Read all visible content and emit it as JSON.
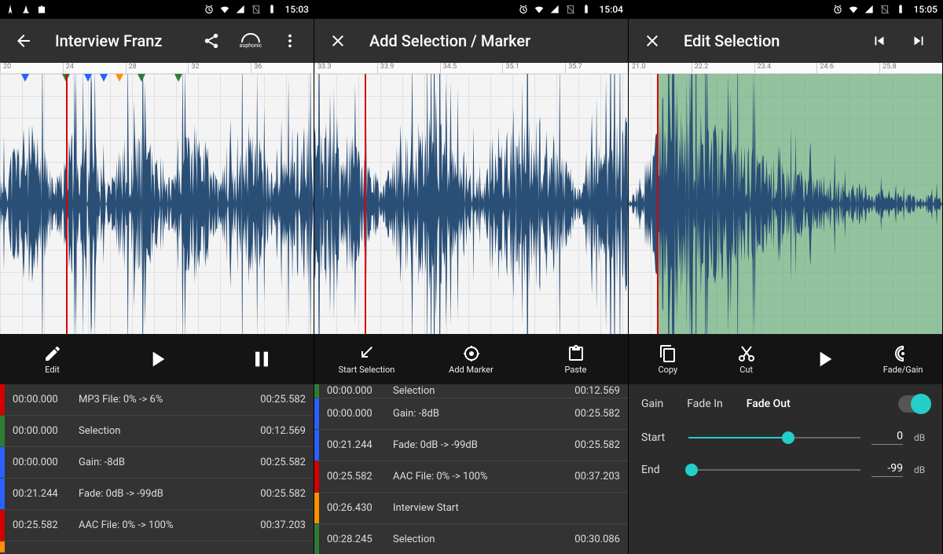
{
  "phones": [
    {
      "status": {
        "time": "15:03"
      },
      "appbar": {
        "nav_icon": "back",
        "title": "Interview Franz",
        "actions": [
          "share",
          "auphonic",
          "overflow"
        ]
      },
      "ruler": [
        "20",
        "24",
        "28",
        "32",
        "36"
      ],
      "playhead_pct": 21,
      "markers": [
        {
          "pct": 8,
          "color": "blue"
        },
        {
          "pct": 21,
          "color": "green"
        },
        {
          "pct": 28,
          "color": "blue"
        },
        {
          "pct": 33,
          "color": "blue"
        },
        {
          "pct": 38,
          "color": "orange"
        },
        {
          "pct": 45,
          "color": "green"
        },
        {
          "pct": 57,
          "color": "green"
        }
      ],
      "controls": [
        {
          "icon": "edit",
          "label": "Edit"
        },
        {
          "icon": "play",
          "label": ""
        },
        {
          "icon": "pause",
          "label": ""
        }
      ],
      "rows": [
        {
          "color": "#d50000",
          "start": "00:00.000",
          "label": "MP3 File: 0% -> 6%",
          "end": "00:25.582"
        },
        {
          "color": "#2e7d32",
          "start": "00:00.000",
          "label": "Selection",
          "end": "00:12.569"
        },
        {
          "color": "#2962ff",
          "start": "00:00.000",
          "label": "Gain: -8dB",
          "end": "00:25.582"
        },
        {
          "color": "#2962ff",
          "start": "00:21.244",
          "label": "Fade: 0dB -> -99dB",
          "end": "00:25.582"
        },
        {
          "color": "#d50000",
          "start": "00:25.582",
          "label": "AAC File: 0% -> 100%",
          "end": "00:37.203"
        }
      ],
      "row_partial_bottom": {
        "color": "#ff9100"
      }
    },
    {
      "status": {
        "time": "15:04"
      },
      "appbar": {
        "nav_icon": "close",
        "title": "Add Selection / Marker",
        "actions": []
      },
      "ruler": [
        "33.3",
        "33.9",
        "34.5",
        "35.1",
        "35.7"
      ],
      "playhead_pct": 16,
      "markers": [],
      "controls": [
        {
          "icon": "crop",
          "label": "Start Selection"
        },
        {
          "icon": "target",
          "label": "Add Marker"
        },
        {
          "icon": "clipboard",
          "label": "Paste"
        }
      ],
      "row_partial_top": {
        "color": "#2e7d32",
        "start": "00:00.000",
        "label": "Selection",
        "end": "00:12.569"
      },
      "rows": [
        {
          "color": "#2962ff",
          "start": "00:00.000",
          "label": "Gain: -8dB",
          "end": "00:25.582"
        },
        {
          "color": "#2962ff",
          "start": "00:21.244",
          "label": "Fade: 0dB -> -99dB",
          "end": "00:25.582"
        },
        {
          "color": "#d50000",
          "start": "00:25.582",
          "label": "AAC File: 0% -> 100%",
          "end": "00:37.203"
        },
        {
          "color": "#ff9100",
          "start": "00:26.430",
          "label": "Interview Start",
          "end": ""
        },
        {
          "color": "#2e7d32",
          "start": "00:28.245",
          "label": "Selection",
          "end": "00:30.086"
        }
      ]
    },
    {
      "status": {
        "time": "15:05"
      },
      "appbar": {
        "nav_icon": "close",
        "title": "Edit Selection",
        "actions": [
          "sel-start",
          "sel-end"
        ]
      },
      "ruler": [
        "21.0",
        "22.2",
        "23.4",
        "24.6",
        "25.8"
      ],
      "playhead_pct": 9,
      "selection": {
        "start_pct": 9,
        "end_pct": 100
      },
      "markers": [],
      "controls": [
        {
          "icon": "copy",
          "label": "Copy"
        },
        {
          "icon": "cut",
          "label": "Cut"
        },
        {
          "icon": "play",
          "label": ""
        },
        {
          "icon": "fadegain",
          "label": "Fade/Gain"
        }
      ],
      "fade_panel": {
        "tabs": [
          "Gain",
          "Fade In",
          "Fade Out"
        ],
        "active_tab": 2,
        "switch_on": true,
        "sliders": [
          {
            "label": "Start",
            "pct": 58,
            "value": "0",
            "unit": "dB"
          },
          {
            "label": "End",
            "pct": 2,
            "value": "-99",
            "unit": "dB"
          }
        ]
      }
    }
  ],
  "icons": {
    "share_label": "share-icon",
    "overflow_label": "overflow-icon"
  }
}
